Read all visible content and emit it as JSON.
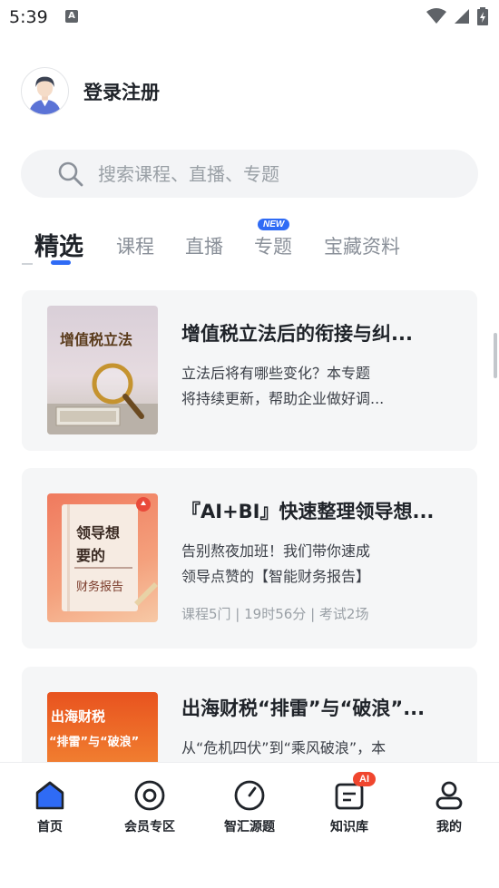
{
  "status_bar": {
    "time": "5:39",
    "notification_icon": "A"
  },
  "login": {
    "label": "登录注册"
  },
  "search": {
    "placeholder": "搜索课程、直播、专题"
  },
  "tabs": [
    {
      "label": "精选",
      "active": true
    },
    {
      "label": "课程"
    },
    {
      "label": "直播"
    },
    {
      "label": "专题",
      "badge": "NEW"
    },
    {
      "label": "宝藏资料"
    }
  ],
  "cards": [
    {
      "thumb_text": "增值税立法",
      "title": "增值税立法后的衔接与纠...",
      "desc_line1": "立法后将有哪些变化？本专题",
      "desc_line2": "将持续更新，帮助企业做好调..."
    },
    {
      "thumb_line1": "领导想",
      "thumb_line2": "要的",
      "thumb_line3": "财务报告",
      "title": "『AI+BI』快速整理领导想...",
      "desc_line1": "告别熬夜加班！我们带你速成",
      "desc_line2": "领导点赞的【智能财务报告】",
      "meta": "课程5门 | 19时56分 | 考试2场"
    },
    {
      "thumb_line1": "出海财税",
      "thumb_line2": "“排雷”与“破浪”",
      "title": "出海财税“排雷”与“破浪”...",
      "desc_line1": "从“危机四伏”到“乘风破浪”，本"
    }
  ],
  "bottom_nav": [
    {
      "label": "首页",
      "icon": "home-icon",
      "active": true
    },
    {
      "label": "会员专区",
      "icon": "target-icon"
    },
    {
      "label": "智汇源题",
      "icon": "compass-icon"
    },
    {
      "label": "知识库",
      "icon": "document-icon",
      "badge": "AI"
    },
    {
      "label": "我的",
      "icon": "person-icon"
    }
  ],
  "colors": {
    "accent": "#2f6bf5",
    "badge_red": "#f0462e",
    "card_bg": "#f5f6f7"
  }
}
